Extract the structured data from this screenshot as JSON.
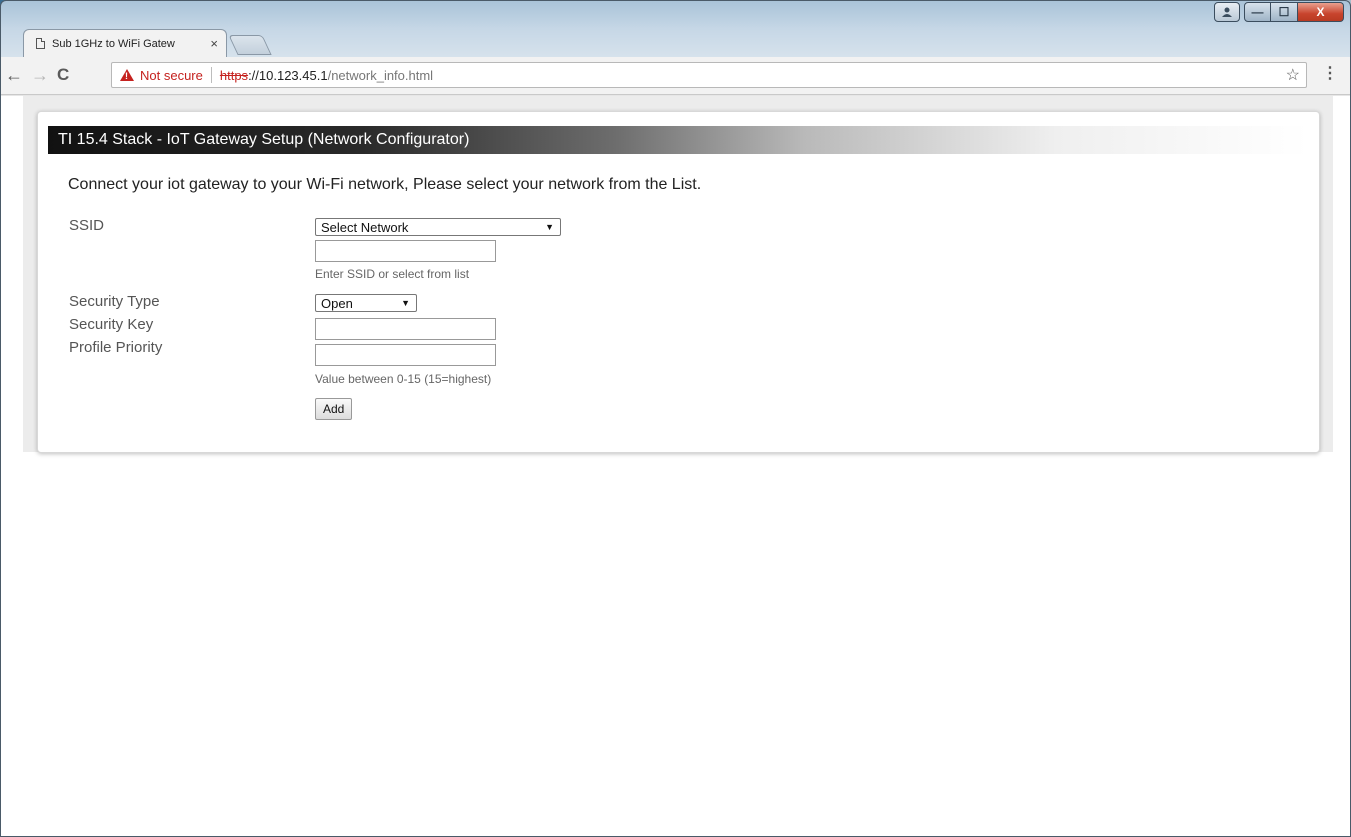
{
  "browser": {
    "tab_title": "Sub 1GHz to WiFi Gatew",
    "tab_close": "×",
    "not_secure": "Not secure",
    "url_scheme": "https",
    "url_host": "://10.123.45.1",
    "url_path": "/network_info.html",
    "star": "☆",
    "menu": "⋮",
    "back": "←",
    "forward": "→",
    "reload": "C",
    "controls": {
      "minimize": "—",
      "maximize": "☐",
      "close": "X"
    }
  },
  "page": {
    "header": "TI 15.4 Stack - IoT Gateway Setup (Network Configurator)",
    "intro": "Connect your iot gateway to your Wi-Fi network, Please select your network from the List.",
    "form": {
      "ssid_label": "SSID",
      "ssid_select": "Select Network",
      "ssid_input_value": "",
      "ssid_hint": "Enter SSID or select from list",
      "security_type_label": "Security Type",
      "security_type_select": "Open",
      "security_key_label": "Security Key",
      "security_key_value": "",
      "priority_label": "Profile Priority",
      "priority_value": "",
      "priority_hint": "Value between 0-15 (15=highest)",
      "add_button": "Add"
    }
  }
}
